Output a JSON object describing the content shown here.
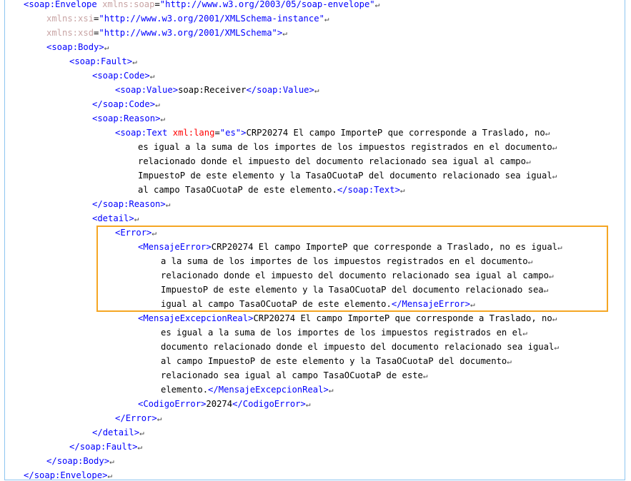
{
  "return_glyph": "↵",
  "lines": [
    {
      "indent": 26,
      "parts": [
        {
          "c": "brk",
          "t": "<"
        },
        {
          "c": "tag",
          "t": "soap:Envelope"
        },
        {
          "c": "txt",
          "t": " "
        },
        {
          "c": "attr",
          "t": "xmlns:soap"
        },
        {
          "c": "txt",
          "t": "="
        },
        {
          "c": "val",
          "t": "\"http://www.w3.org/2003/05/soap-envelope\""
        }
      ]
    },
    {
      "indent": 58,
      "parts": [
        {
          "c": "attr",
          "t": "xmlns:xsi"
        },
        {
          "c": "txt",
          "t": "="
        },
        {
          "c": "val",
          "t": "\"http://www.w3.org/2001/XMLSchema-instance\""
        }
      ]
    },
    {
      "indent": 58,
      "parts": [
        {
          "c": "attr",
          "t": "xmlns:xsd"
        },
        {
          "c": "txt",
          "t": "="
        },
        {
          "c": "val",
          "t": "\"http://www.w3.org/2001/XMLSchema\""
        },
        {
          "c": "brk",
          "t": ">"
        }
      ]
    },
    {
      "indent": 58,
      "parts": [
        {
          "c": "brk",
          "t": "<"
        },
        {
          "c": "tag",
          "t": "soap:Body"
        },
        {
          "c": "brk",
          "t": ">"
        }
      ]
    },
    {
      "indent": 90,
      "parts": [
        {
          "c": "brk",
          "t": "<"
        },
        {
          "c": "tag",
          "t": "soap:Fault"
        },
        {
          "c": "brk",
          "t": ">"
        }
      ]
    },
    {
      "indent": 122,
      "parts": [
        {
          "c": "brk",
          "t": "<"
        },
        {
          "c": "tag",
          "t": "soap:Code"
        },
        {
          "c": "brk",
          "t": ">"
        }
      ]
    },
    {
      "indent": 154,
      "parts": [
        {
          "c": "brk",
          "t": "<"
        },
        {
          "c": "tag",
          "t": "soap:Value"
        },
        {
          "c": "brk",
          "t": ">"
        },
        {
          "c": "txt",
          "t": "soap:Receiver"
        },
        {
          "c": "brk",
          "t": "</"
        },
        {
          "c": "tag",
          "t": "soap:Value"
        },
        {
          "c": "brk",
          "t": ">"
        }
      ]
    },
    {
      "indent": 122,
      "parts": [
        {
          "c": "brk",
          "t": "</"
        },
        {
          "c": "tag",
          "t": "soap:Code"
        },
        {
          "c": "brk",
          "t": ">"
        }
      ]
    },
    {
      "indent": 122,
      "parts": [
        {
          "c": "brk",
          "t": "<"
        },
        {
          "c": "tag",
          "t": "soap:Reason"
        },
        {
          "c": "brk",
          "t": ">"
        }
      ]
    },
    {
      "indent": 154,
      "parts": [
        {
          "c": "brk",
          "t": "<"
        },
        {
          "c": "tag",
          "t": "soap:Text"
        },
        {
          "c": "txt",
          "t": " "
        },
        {
          "c": "attrvis",
          "t": "xml:lang"
        },
        {
          "c": "txt",
          "t": "="
        },
        {
          "c": "val",
          "t": "\"es\""
        },
        {
          "c": "brk",
          "t": ">"
        },
        {
          "c": "txt",
          "t": "CRP20274 El campo ImporteP que corresponde a Traslado, no"
        }
      ]
    },
    {
      "indent": 186,
      "parts": [
        {
          "c": "txt",
          "t": "es igual a la suma de los importes de los impuestos registrados en el documento"
        }
      ]
    },
    {
      "indent": 186,
      "parts": [
        {
          "c": "txt",
          "t": "relacionado donde el impuesto del documento relacionado sea igual al campo"
        }
      ]
    },
    {
      "indent": 186,
      "parts": [
        {
          "c": "txt",
          "t": "ImpuestoP de este elemento y la TasaOCuotaP del documento relacionado sea igual"
        }
      ]
    },
    {
      "indent": 186,
      "parts": [
        {
          "c": "txt",
          "t": "al campo TasaOCuotaP de este elemento."
        },
        {
          "c": "brk",
          "t": "</"
        },
        {
          "c": "tag",
          "t": "soap:Text"
        },
        {
          "c": "brk",
          "t": ">"
        }
      ]
    },
    {
      "indent": 122,
      "parts": [
        {
          "c": "brk",
          "t": "</"
        },
        {
          "c": "tag",
          "t": "soap:Reason"
        },
        {
          "c": "brk",
          "t": ">"
        }
      ]
    },
    {
      "indent": 122,
      "parts": [
        {
          "c": "brk",
          "t": "<"
        },
        {
          "c": "tag",
          "t": "detail"
        },
        {
          "c": "brk",
          "t": ">"
        }
      ]
    },
    {
      "indent": 154,
      "parts": [
        {
          "c": "brk",
          "t": "<"
        },
        {
          "c": "tag",
          "t": "Error"
        },
        {
          "c": "brk",
          "t": ">"
        }
      ]
    },
    {
      "indent": 186,
      "parts": [
        {
          "c": "brk",
          "t": "<"
        },
        {
          "c": "tag",
          "t": "MensajeError"
        },
        {
          "c": "brk",
          "t": ">"
        },
        {
          "c": "txt",
          "t": "CRP20274 El campo ImporteP que corresponde a Traslado, no es igual"
        }
      ]
    },
    {
      "indent": 218,
      "parts": [
        {
          "c": "txt",
          "t": "a la suma de los importes de los impuestos registrados en el documento"
        }
      ]
    },
    {
      "indent": 218,
      "parts": [
        {
          "c": "txt",
          "t": "relacionado donde el impuesto del documento relacionado sea igual al campo"
        }
      ]
    },
    {
      "indent": 218,
      "parts": [
        {
          "c": "txt",
          "t": "ImpuestoP de este elemento y la TasaOCuotaP del documento relacionado sea"
        }
      ]
    },
    {
      "indent": 218,
      "parts": [
        {
          "c": "txt",
          "t": "igual al campo TasaOCuotaP de este elemento."
        },
        {
          "c": "brk",
          "t": "</"
        },
        {
          "c": "tag",
          "t": "MensajeError"
        },
        {
          "c": "brk",
          "t": ">"
        }
      ]
    },
    {
      "indent": 186,
      "parts": [
        {
          "c": "brk",
          "t": "<"
        },
        {
          "c": "tag",
          "t": "MensajeExcepcionReal"
        },
        {
          "c": "brk",
          "t": ">"
        },
        {
          "c": "txt",
          "t": "CRP20274 El campo ImporteP que corresponde a Traslado, no"
        }
      ]
    },
    {
      "indent": 218,
      "parts": [
        {
          "c": "txt",
          "t": "es igual a la suma de los importes de los impuestos registrados en el"
        }
      ]
    },
    {
      "indent": 218,
      "parts": [
        {
          "c": "txt",
          "t": "documento relacionado donde el impuesto del documento relacionado sea igual"
        }
      ]
    },
    {
      "indent": 218,
      "parts": [
        {
          "c": "txt",
          "t": "al campo ImpuestoP de este elemento y la TasaOCuotaP del documento"
        }
      ]
    },
    {
      "indent": 218,
      "parts": [
        {
          "c": "txt",
          "t": "relacionado sea igual al campo TasaOCuotaP de este"
        }
      ]
    },
    {
      "indent": 218,
      "parts": [
        {
          "c": "txt",
          "t": "elemento."
        },
        {
          "c": "brk",
          "t": "</"
        },
        {
          "c": "tag",
          "t": "MensajeExcepcionReal"
        },
        {
          "c": "brk",
          "t": ">"
        }
      ]
    },
    {
      "indent": 186,
      "parts": [
        {
          "c": "brk",
          "t": "<"
        },
        {
          "c": "tag",
          "t": "CodigoError"
        },
        {
          "c": "brk",
          "t": ">"
        },
        {
          "c": "txt",
          "t": "20274"
        },
        {
          "c": "brk",
          "t": "</"
        },
        {
          "c": "tag",
          "t": "CodigoError"
        },
        {
          "c": "brk",
          "t": ">"
        }
      ]
    },
    {
      "indent": 154,
      "parts": [
        {
          "c": "brk",
          "t": "</"
        },
        {
          "c": "tag",
          "t": "Error"
        },
        {
          "c": "brk",
          "t": ">"
        }
      ]
    },
    {
      "indent": 122,
      "parts": [
        {
          "c": "brk",
          "t": "</"
        },
        {
          "c": "tag",
          "t": "detail"
        },
        {
          "c": "brk",
          "t": ">"
        }
      ]
    },
    {
      "indent": 90,
      "parts": [
        {
          "c": "brk",
          "t": "</"
        },
        {
          "c": "tag",
          "t": "soap:Fault"
        },
        {
          "c": "brk",
          "t": ">"
        }
      ]
    },
    {
      "indent": 58,
      "parts": [
        {
          "c": "brk",
          "t": "</"
        },
        {
          "c": "tag",
          "t": "soap:Body"
        },
        {
          "c": "brk",
          "t": ">"
        }
      ]
    },
    {
      "indent": 26,
      "parts": [
        {
          "c": "brk",
          "t": "</"
        },
        {
          "c": "tag",
          "t": "soap:Envelope"
        },
        {
          "c": "brk",
          "t": ">"
        }
      ]
    }
  ]
}
